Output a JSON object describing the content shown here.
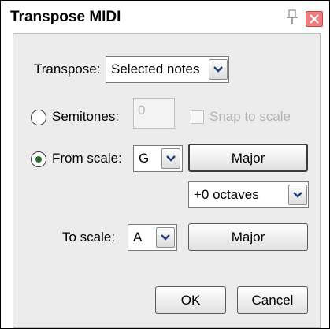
{
  "window": {
    "title": "Transpose MIDI"
  },
  "transpose": {
    "label": "Transpose:",
    "value": "Selected notes"
  },
  "semitones": {
    "label": "Semitones:",
    "value": "0",
    "selected": false
  },
  "snap": {
    "label": "Snap to scale",
    "checked": false
  },
  "from_scale": {
    "label": "From scale:",
    "key": "G",
    "mode": "Major",
    "selected": true
  },
  "octaves": {
    "value": "+0 octaves"
  },
  "to_scale": {
    "label": "To scale:",
    "key": "A",
    "mode": "Major"
  },
  "buttons": {
    "ok": "OK",
    "cancel": "Cancel"
  },
  "icons": {
    "pin": "pin-icon",
    "close": "close-icon"
  },
  "colors": {
    "close_button": "#f07d7d",
    "radio_dot": "#2a6a2a"
  }
}
